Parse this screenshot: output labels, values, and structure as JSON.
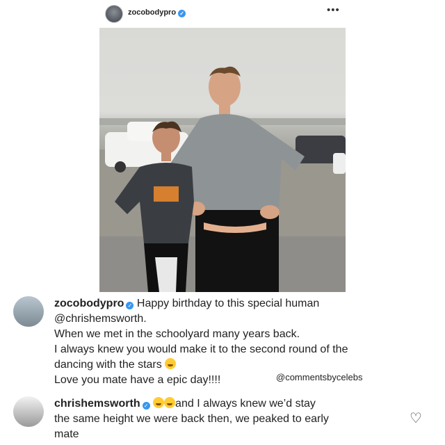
{
  "post": {
    "username": "zocobodypro",
    "more_label": "•••"
  },
  "comments": [
    {
      "username": "zocobodypro",
      "lines": [
        "Happy birthday to this special human",
        "@chrishemsworth.",
        "When we met in the schoolyard many years back.",
        "I always knew you would make it to the second round of the",
        "dancing with the stars",
        "Love you mate have a epic day!!!!"
      ]
    },
    {
      "username": "chrishemsworth",
      "lines": [
        "and I always knew we’d stay",
        "the same height we were back then, we peaked to early",
        "mate"
      ]
    }
  ],
  "watermark": "@commentsbycelebs",
  "icons": {
    "verified": "verified-badge-icon",
    "heart": "heart-icon",
    "more": "more-icon"
  },
  "colors": {
    "verified": "#3897f0"
  }
}
